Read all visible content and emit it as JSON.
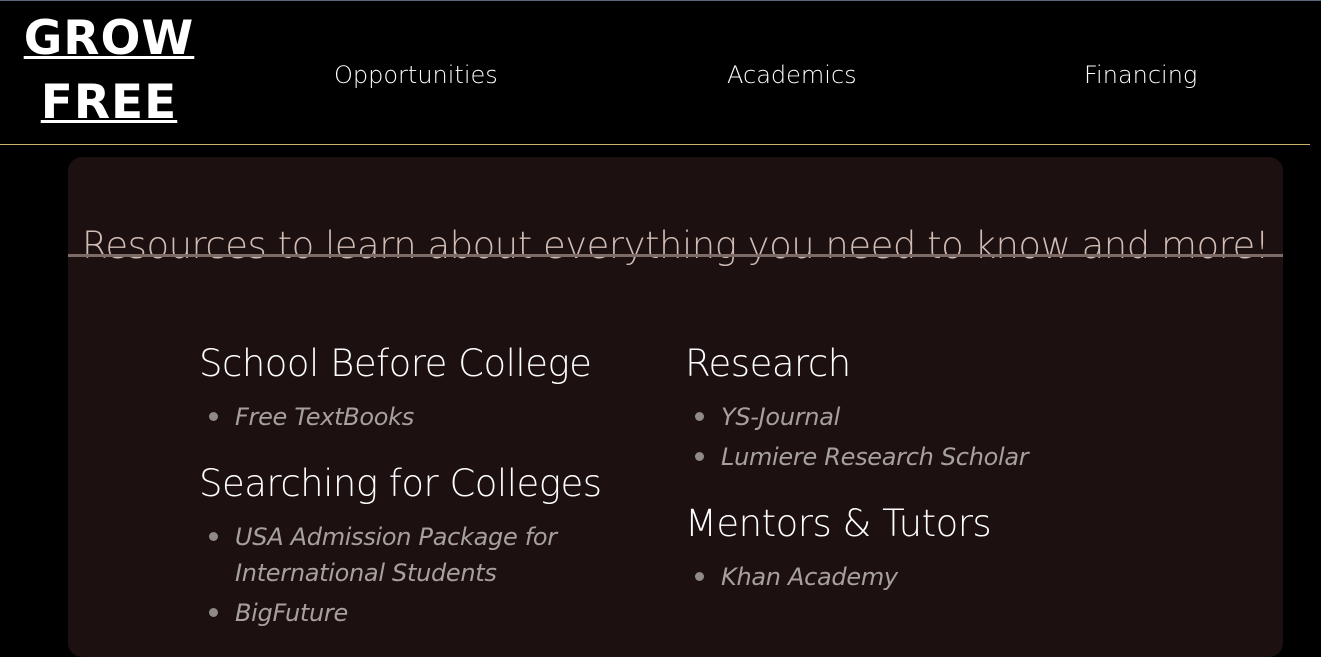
{
  "header": {
    "logo_line1": "GROW",
    "logo_line2": "FREE",
    "nav": [
      {
        "label": "Opportunities"
      },
      {
        "label": "Academics"
      },
      {
        "label": "Financing"
      }
    ]
  },
  "main": {
    "title": "Resources to learn about everything you need to know and more!",
    "columns": [
      {
        "sections": [
          {
            "heading": "School Before College",
            "links": [
              "Free TextBooks"
            ]
          },
          {
            "heading": "Searching for Colleges",
            "links": [
              "USA Admission Package for International Students",
              "BigFuture"
            ]
          }
        ]
      },
      {
        "sections": [
          {
            "heading": "Research",
            "links": [
              "YS-Journal",
              "Lumiere Research Scholar"
            ]
          },
          {
            "heading": "Mentors & Tutors",
            "links": [
              "Khan Academy"
            ]
          }
        ]
      }
    ]
  },
  "colors": {
    "background": "#000000",
    "card": "#1c1010",
    "header_rule": "#c9b26e",
    "card_rule": "#7b6a66",
    "title_text": "#d0bcb4",
    "link_text": "#a6a09e"
  }
}
